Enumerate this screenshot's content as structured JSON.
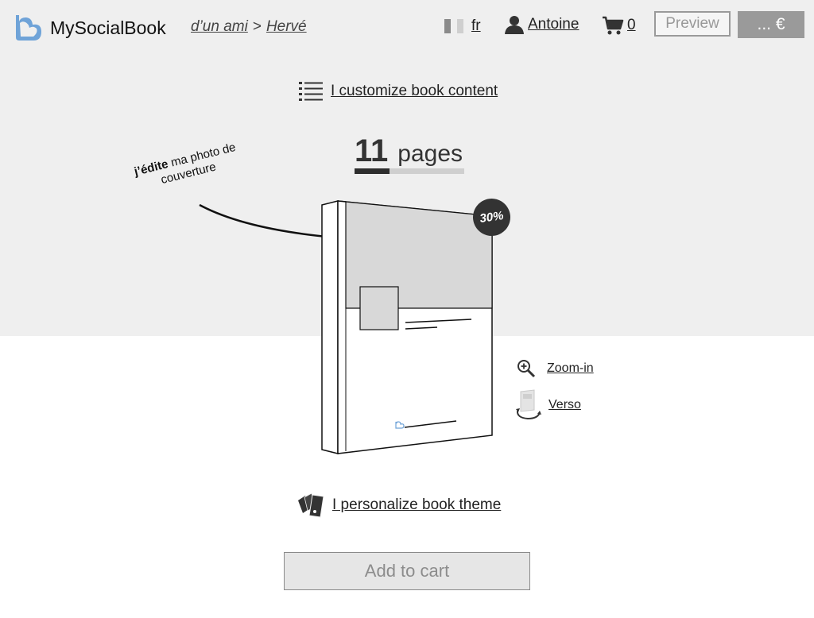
{
  "app": {
    "name": "MySocialBook"
  },
  "breadcrumb": {
    "items": [
      "d’un ami",
      "Hervé"
    ],
    "separator": ">"
  },
  "header": {
    "language": "fr",
    "user_name": "Antoine",
    "cart_count": "0",
    "preview_label": "Preview",
    "price_label": "... €"
  },
  "customize": {
    "label": "I customize book content"
  },
  "pages": {
    "count": "11",
    "unit": "pages",
    "progress_fraction": 0.32
  },
  "annotation": {
    "bold": "j’édite",
    "rest": " ma photo de couverture"
  },
  "book": {
    "discount_badge": "30%"
  },
  "actions": {
    "zoom_label": "Zoom-in",
    "verso_label": "Verso"
  },
  "theme": {
    "label": "I personalize book theme"
  },
  "cart_button": {
    "label": "Add to cart"
  },
  "colors": {
    "brand_blue": "#6fa3d8",
    "band_gray": "#efefef",
    "button_gray": "#9a9a9a",
    "dark": "#333333"
  },
  "icons": [
    "heart-logo-icon",
    "flag-icon",
    "user-icon",
    "cart-icon",
    "list-icon",
    "zoom-in-icon",
    "flip-icon",
    "cards-icon"
  ]
}
